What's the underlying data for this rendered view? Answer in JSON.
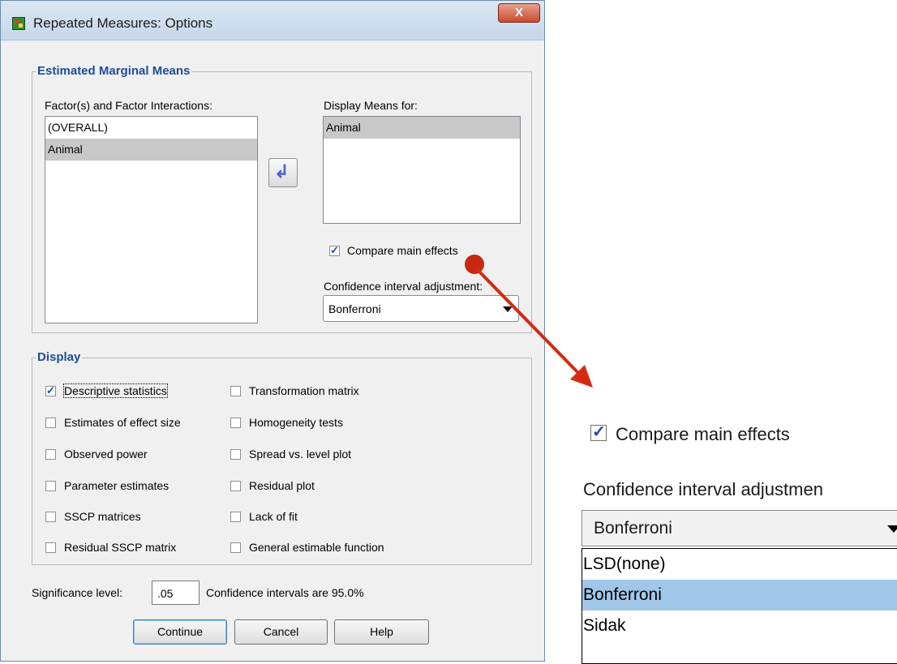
{
  "window": {
    "title": "Repeated Measures: Options",
    "close_glyph": "X"
  },
  "emm": {
    "group_title": "Estimated Marginal Means",
    "factors_label": "Factor(s) and Factor Interactions:",
    "factors": [
      "(OVERALL)",
      "Animal"
    ],
    "display_label": "Display Means for:",
    "display_items": [
      "Animal"
    ],
    "compare_label": "Compare main effects",
    "compare_checked": true,
    "ci_label": "Confidence interval adjustment:",
    "ci_value": "Bonferroni"
  },
  "display": {
    "group_title": "Display",
    "left": [
      {
        "label": "Descriptive statistics",
        "checked": true
      },
      {
        "label": "Estimates of effect size",
        "checked": false
      },
      {
        "label": "Observed power",
        "checked": false
      },
      {
        "label": "Parameter estimates",
        "checked": false
      },
      {
        "label": "SSCP matrices",
        "checked": false
      },
      {
        "label": "Residual SSCP matrix",
        "checked": false
      }
    ],
    "right": [
      {
        "label": "Transformation matrix",
        "checked": false
      },
      {
        "label": "Homogeneity tests",
        "checked": false
      },
      {
        "label": "Spread vs. level plot",
        "checked": false
      },
      {
        "label": "Residual plot",
        "checked": false
      },
      {
        "label": "Lack of fit",
        "checked": false
      },
      {
        "label": "General estimable function",
        "checked": false
      }
    ]
  },
  "significance": {
    "label": "Significance level:",
    "value": ".05",
    "ci_text": "Confidence intervals are 95.0%"
  },
  "buttons": {
    "continue": "Continue",
    "cancel": "Cancel",
    "help": "Help"
  },
  "zoom": {
    "compare_label": "Compare main effects",
    "ci_label": "Confidence interval adjustmen",
    "ci_value": "Bonferroni",
    "options": [
      "LSD(none)",
      "Bonferroni",
      "Sidak"
    ],
    "selected_option": "Bonferroni"
  },
  "colors": {
    "accent": "#1c4e96",
    "annotation": "#d42a12",
    "selection": "#a0c7e8"
  }
}
